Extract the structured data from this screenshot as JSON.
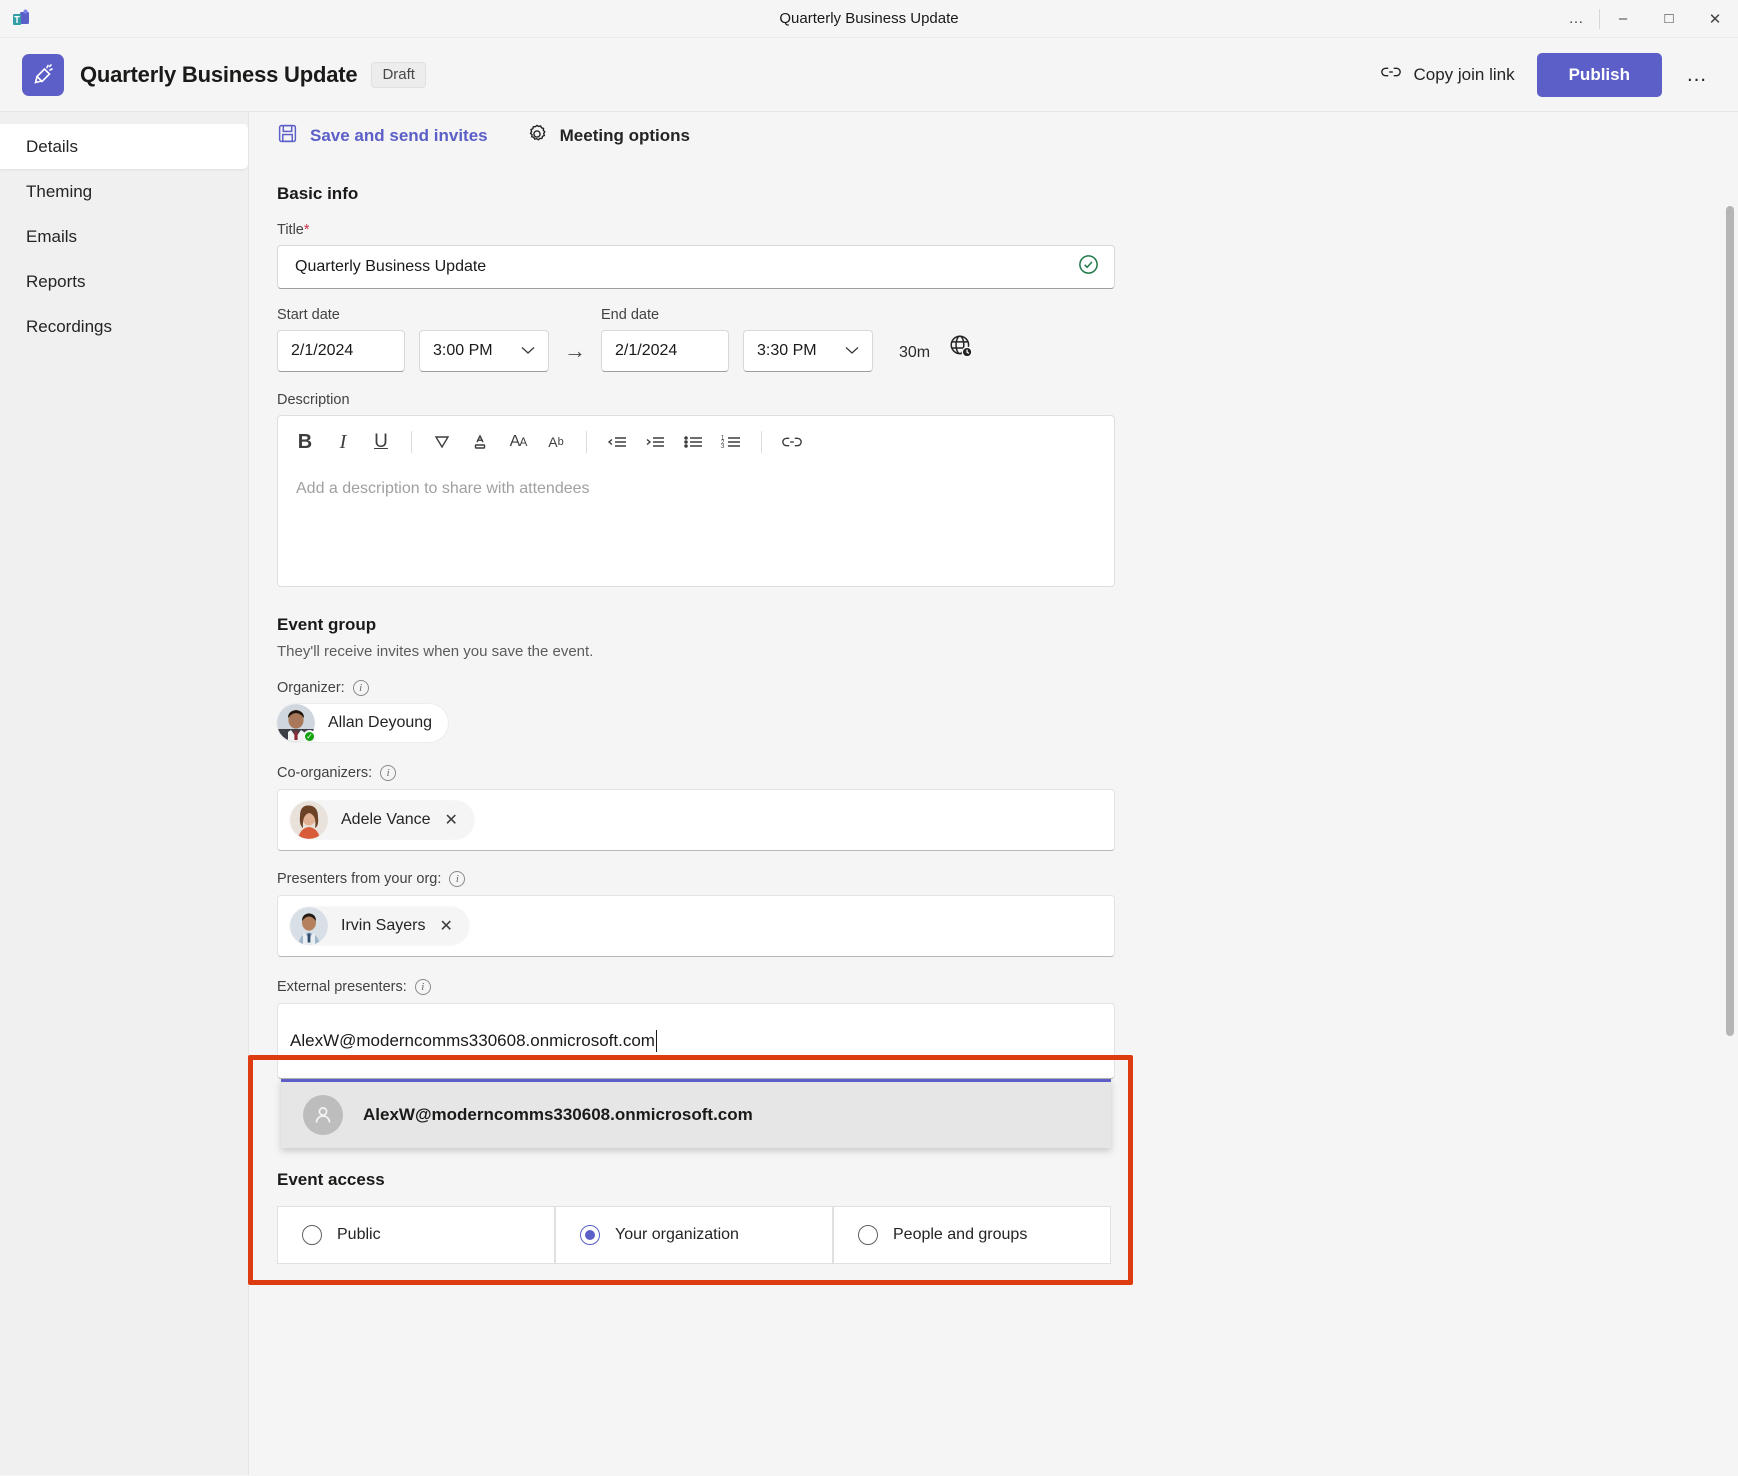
{
  "window": {
    "title": "Quarterly Business Update",
    "app_icon": "teams-icon",
    "controls": {
      "more": "…",
      "minimize": "–",
      "maximize": "□",
      "close": "✕"
    }
  },
  "header": {
    "event_icon": "event-megaphone-icon",
    "title": "Quarterly Business Update",
    "status_badge": "Draft",
    "copy_join_link": "Copy join link",
    "publish": "Publish",
    "more": "…",
    "accent_color": "#5b5fc7"
  },
  "sidebar": {
    "items": [
      {
        "label": "Details",
        "active": true
      },
      {
        "label": "Theming",
        "active": false
      },
      {
        "label": "Emails",
        "active": false
      },
      {
        "label": "Reports",
        "active": false
      },
      {
        "label": "Recordings",
        "active": false
      }
    ]
  },
  "toolbar": {
    "save_and_send": "Save and send invites",
    "meeting_options": "Meeting options"
  },
  "basic_info": {
    "section_title": "Basic info",
    "title_label": "Title",
    "title_required_mark": "*",
    "title_value": "Quarterly Business Update",
    "valid_icon": "checkmark-circle-icon",
    "start_date_label": "Start date",
    "end_date_label": "End date",
    "start_date": "2/1/2024",
    "start_time": "3:00 PM",
    "end_date": "2/1/2024",
    "end_time": "3:30 PM",
    "duration": "30m",
    "timezone_icon": "globe-clock-icon",
    "arrow": "→",
    "description_label": "Description",
    "description_placeholder": "Add a description to share with attendees",
    "editor_tools": [
      {
        "icon": "bold-icon",
        "glyph": "B"
      },
      {
        "icon": "italic-icon",
        "glyph": "I"
      },
      {
        "icon": "underline-icon",
        "glyph": "U"
      },
      {
        "icon": "highlight-color-icon",
        "glyph": "∇"
      },
      {
        "icon": "font-color-icon",
        "glyph": "A"
      },
      {
        "icon": "font-size-icon",
        "glyph": "AA"
      },
      {
        "icon": "clear-formatting-icon",
        "glyph": "Ab"
      },
      {
        "icon": "decrease-indent-icon",
        "glyph": "⇤"
      },
      {
        "icon": "increase-indent-icon",
        "glyph": "⇥"
      },
      {
        "icon": "bulleted-list-icon",
        "glyph": "≡"
      },
      {
        "icon": "numbered-list-icon",
        "glyph": "≣"
      },
      {
        "icon": "link-icon",
        "glyph": "⚭"
      }
    ]
  },
  "event_group": {
    "section_title": "Event group",
    "subtitle": "They'll receive invites when you save the event.",
    "organizer_label": "Organizer:",
    "organizer": {
      "name": "Allan Deyoung",
      "presence": "available"
    },
    "co_organizers_label": "Co-organizers:",
    "co_organizers": [
      {
        "name": "Adele Vance",
        "remove": "✕"
      }
    ],
    "presenters_label": "Presenters from your org:",
    "presenters": [
      {
        "name": "Irvin Sayers",
        "remove": "✕"
      }
    ],
    "external_presenters_label": "External presenters:",
    "external_presenter_input": "AlexW@moderncomms330608.onmicrosoft.com",
    "suggestion": {
      "avatar_icon": "person-icon",
      "text": "AlexW@moderncomms330608.onmicrosoft.com"
    },
    "highlight_color": "#dd3c10"
  },
  "event_access": {
    "section_title": "Event access",
    "options": [
      {
        "label": "Public",
        "selected": false
      },
      {
        "label": "Your organization",
        "selected": true
      },
      {
        "label": "People and groups",
        "selected": false
      }
    ]
  }
}
